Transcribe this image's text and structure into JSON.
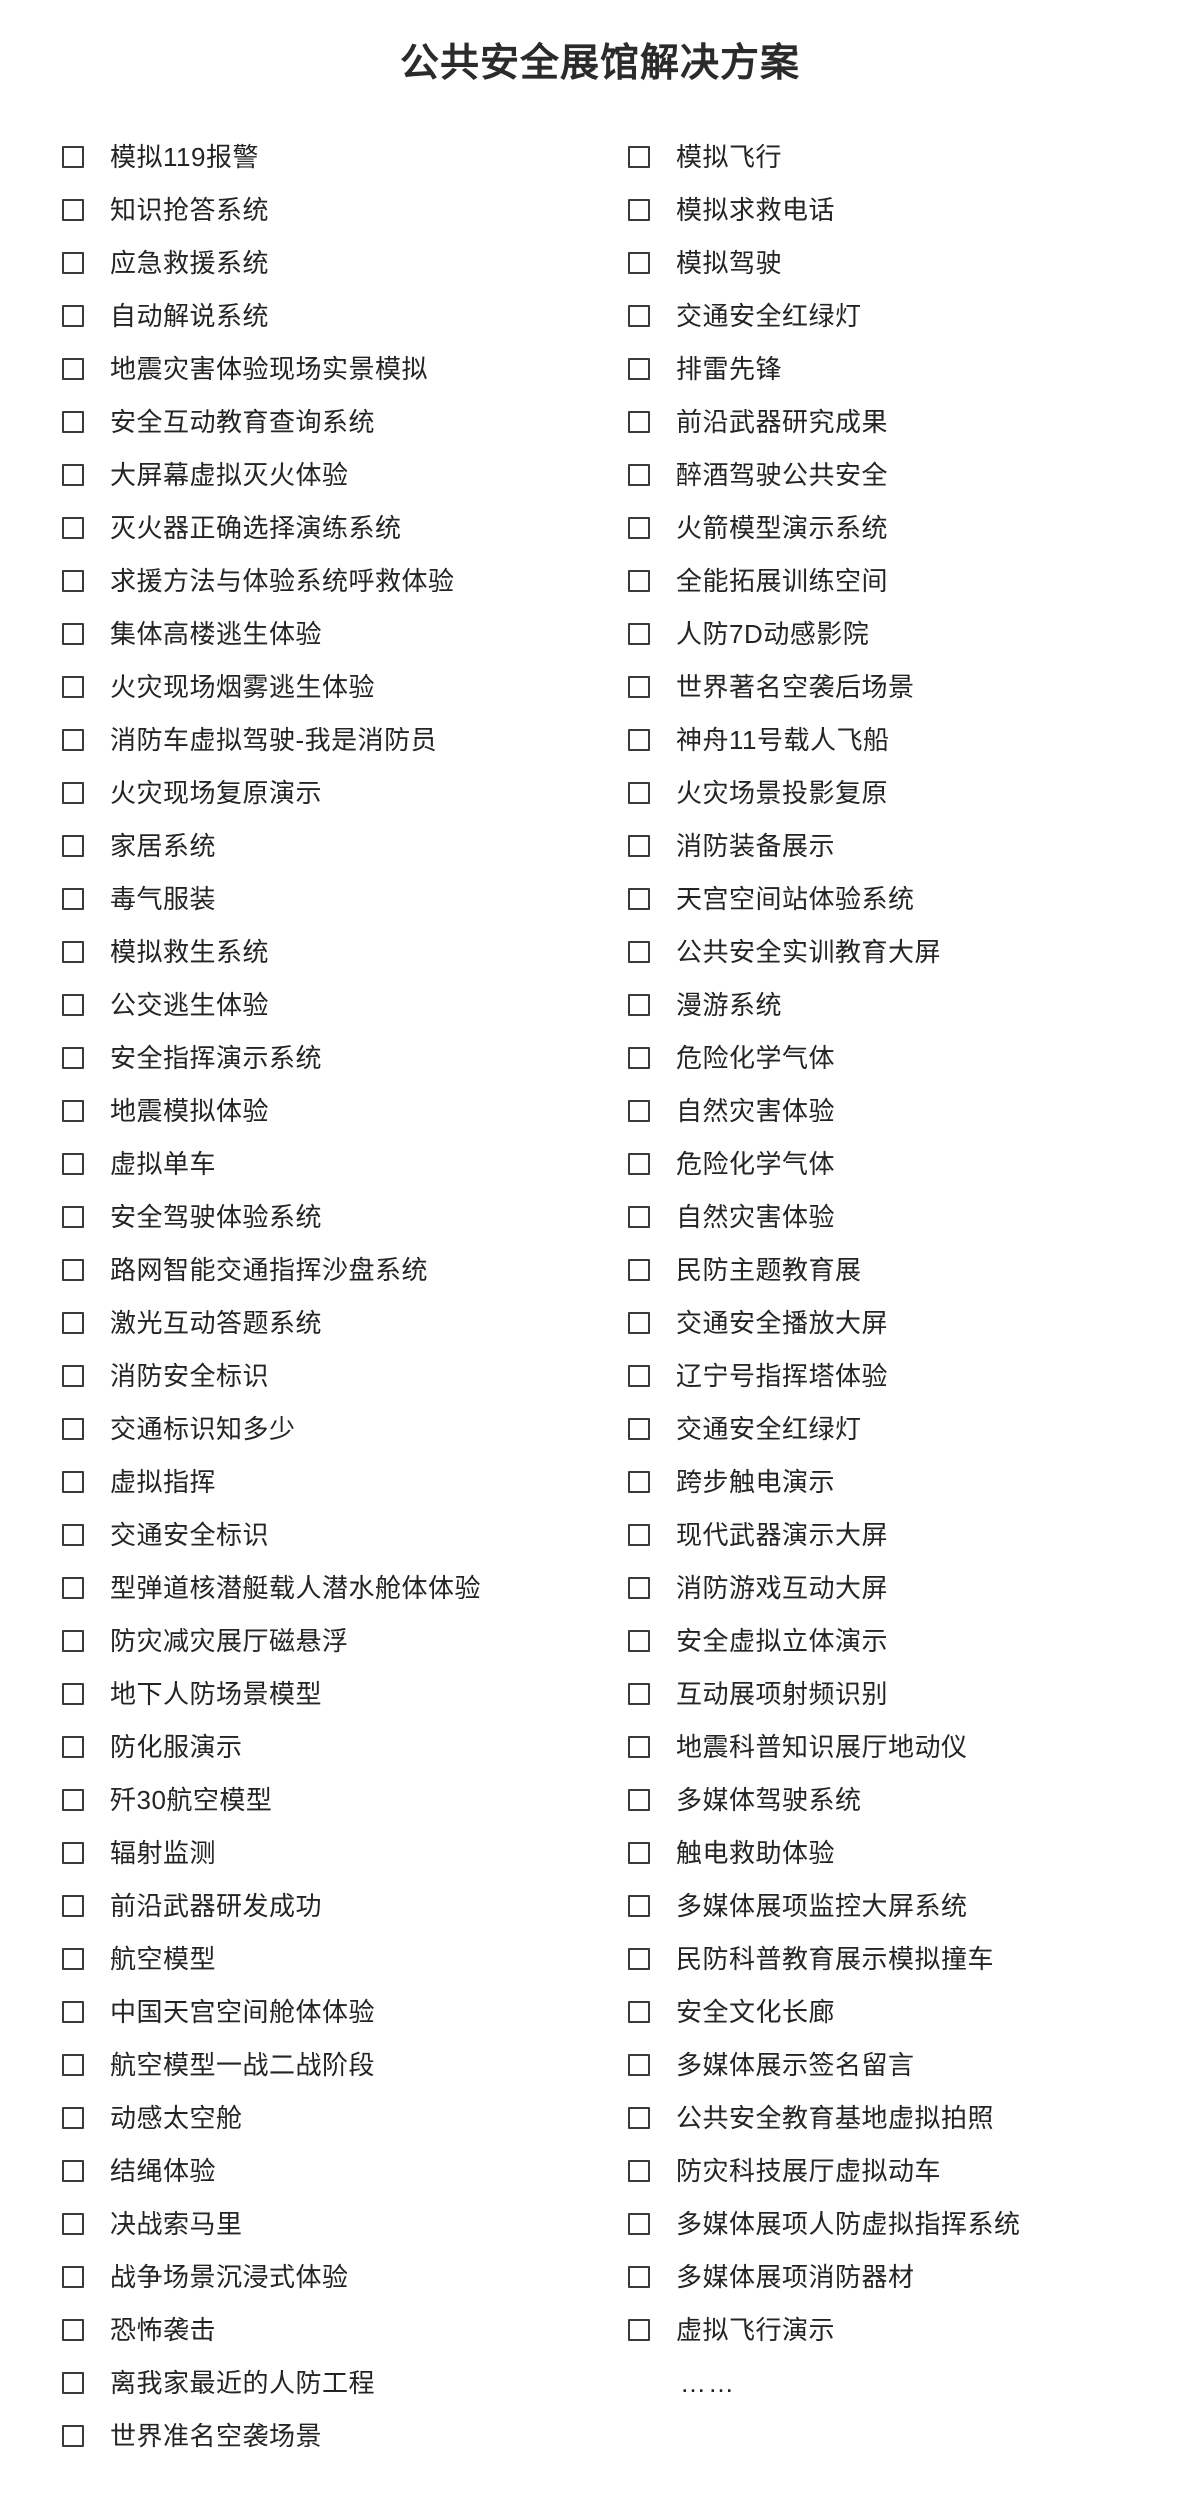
{
  "document": {
    "title": "公共安全展馆解决方案",
    "background_color": "#ffffff",
    "text_color": "#242424",
    "checkbox_border_color": "#3a3a3a"
  },
  "columns": {
    "left": {
      "items": [
        {
          "label": "模拟119报警",
          "checked": false
        },
        {
          "label": "知识抢答系统",
          "checked": false
        },
        {
          "label": "应急救援系统",
          "checked": false
        },
        {
          "label": "自动解说系统",
          "checked": false
        },
        {
          "label": "地震灾害体验现场实景模拟",
          "checked": false
        },
        {
          "label": "安全互动教育查询系统",
          "checked": false
        },
        {
          "label": "大屏幕虚拟灭火体验",
          "checked": false
        },
        {
          "label": "灭火器正确选择演练系统",
          "checked": false
        },
        {
          "label": "求援方法与体验系统呼救体验",
          "checked": false
        },
        {
          "label": "集体高楼逃生体验",
          "checked": false
        },
        {
          "label": "火灾现场烟雾逃生体验",
          "checked": false
        },
        {
          "label": "消防车虚拟驾驶-我是消防员",
          "checked": false
        },
        {
          "label": "火灾现场复原演示",
          "checked": false
        },
        {
          "label": "家居系统",
          "checked": false
        },
        {
          "label": "毒气服装",
          "checked": false
        },
        {
          "label": "模拟救生系统",
          "checked": false
        },
        {
          "label": "公交逃生体验",
          "checked": false
        },
        {
          "label": "安全指挥演示系统",
          "checked": false
        },
        {
          "label": "地震模拟体验",
          "checked": false
        },
        {
          "label": "虚拟单车",
          "checked": false
        },
        {
          "label": "安全驾驶体验系统",
          "checked": false
        },
        {
          "label": "路网智能交通指挥沙盘系统",
          "checked": false
        },
        {
          "label": "激光互动答题系统",
          "checked": false
        },
        {
          "label": "消防安全标识",
          "checked": false
        },
        {
          "label": "交通标识知多少",
          "checked": false
        },
        {
          "label": "虚拟指挥",
          "checked": false
        },
        {
          "label": "交通安全标识",
          "checked": false
        },
        {
          "label": "型弹道核潜艇载人潜水舱体体验",
          "checked": false
        },
        {
          "label": "防灾减灾展厅磁悬浮",
          "checked": false
        },
        {
          "label": "地下人防场景模型",
          "checked": false
        },
        {
          "label": "防化服演示",
          "checked": false
        },
        {
          "label": "歼30航空模型",
          "checked": false
        },
        {
          "label": "辐射监测",
          "checked": false
        },
        {
          "label": "前沿武器研发成功",
          "checked": false
        },
        {
          "label": "航空模型",
          "checked": false
        },
        {
          "label": "中国天宫空间舱体体验",
          "checked": false
        },
        {
          "label": "航空模型一战二战阶段",
          "checked": false
        },
        {
          "label": "动感太空舱",
          "checked": false
        },
        {
          "label": "结绳体验",
          "checked": false
        },
        {
          "label": "决战索马里",
          "checked": false
        },
        {
          "label": "战争场景沉浸式体验",
          "checked": false
        },
        {
          "label": "恐怖袭击",
          "checked": false
        },
        {
          "label": "离我家最近的人防工程",
          "checked": false
        },
        {
          "label": "世界准名空袭场景",
          "checked": false
        }
      ]
    },
    "right": {
      "items": [
        {
          "label": "模拟飞行",
          "checked": false
        },
        {
          "label": "模拟求救电话",
          "checked": false
        },
        {
          "label": "模拟驾驶",
          "checked": false
        },
        {
          "label": "交通安全红绿灯",
          "checked": false
        },
        {
          "label": "排雷先锋",
          "checked": false
        },
        {
          "label": "前沿武器研究成果",
          "checked": false
        },
        {
          "label": "醉酒驾驶公共安全",
          "checked": false
        },
        {
          "label": "火箭模型演示系统",
          "checked": false
        },
        {
          "label": "全能拓展训练空间",
          "checked": false
        },
        {
          "label": "人防7D动感影院",
          "checked": false
        },
        {
          "label": "世界著名空袭后场景",
          "checked": false
        },
        {
          "label": "神舟11号载人飞船",
          "checked": false
        },
        {
          "label": "火灾场景投影复原",
          "checked": false
        },
        {
          "label": "消防装备展示",
          "checked": false
        },
        {
          "label": "天宫空间站体验系统",
          "checked": false
        },
        {
          "label": "公共安全实训教育大屏",
          "checked": false
        },
        {
          "label": "漫游系统",
          "checked": false
        },
        {
          "label": "危险化学气体",
          "checked": false
        },
        {
          "label": "自然灾害体验",
          "checked": false
        },
        {
          "label": "危险化学气体",
          "checked": false
        },
        {
          "label": "自然灾害体验",
          "checked": false
        },
        {
          "label": "民防主题教育展",
          "checked": false
        },
        {
          "label": "交通安全播放大屏",
          "checked": false
        },
        {
          "label": "辽宁号指挥塔体验",
          "checked": false
        },
        {
          "label": "交通安全红绿灯",
          "checked": false
        },
        {
          "label": "跨步触电演示",
          "checked": false
        },
        {
          "label": "现代武器演示大屏",
          "checked": false
        },
        {
          "label": "消防游戏互动大屏",
          "checked": false
        },
        {
          "label": "安全虚拟立体演示",
          "checked": false
        },
        {
          "label": "互动展项射频识别",
          "checked": false
        },
        {
          "label": "地震科普知识展厅地动仪",
          "checked": false
        },
        {
          "label": "多媒体驾驶系统",
          "checked": false
        },
        {
          "label": "触电救助体验",
          "checked": false
        },
        {
          "label": "多媒体展项监控大屏系统",
          "checked": false
        },
        {
          "label": "民防科普教育展示模拟撞车",
          "checked": false
        },
        {
          "label": "安全文化长廊",
          "checked": false
        },
        {
          "label": "多媒体展示签名留言",
          "checked": false
        },
        {
          "label": "公共安全教育基地虚拟拍照",
          "checked": false
        },
        {
          "label": "防灾科技展厅虚拟动车",
          "checked": false
        },
        {
          "label": "多媒体展项人防虚拟指挥系统",
          "checked": false
        },
        {
          "label": "多媒体展项消防器材",
          "checked": false
        },
        {
          "label": "虚拟飞行演示",
          "checked": false
        }
      ],
      "more_indicator": "……"
    }
  }
}
